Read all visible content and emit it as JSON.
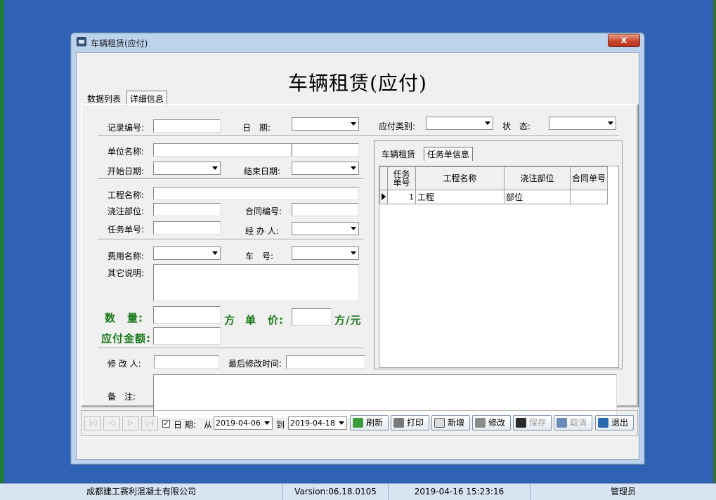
{
  "window": {
    "title": "车辆租赁(应付)",
    "close_label": "x",
    "heading": "车辆租赁(应付)"
  },
  "tabs": [
    {
      "label": "数据列表",
      "active": false
    },
    {
      "label": "详细信息",
      "active": true
    }
  ],
  "form": {
    "record_no_label": "记录编号:",
    "date_label": "日　期:",
    "payable_type_label": "应付类别:",
    "status_label": "状　态:",
    "unit_name_label": "单位名称:",
    "start_date_label": "开始日期:",
    "end_date_label": "结束日期:",
    "project_name_label": "工程名称:",
    "pour_part_label": "浇注部位:",
    "contract_no_label": "合同编号:",
    "task_no_label": "任务单号:",
    "handler_label": "经 办 人:",
    "fee_name_label": "费用名称:",
    "vehicle_no_label": "车　号:",
    "other_desc_label": "其它说明:",
    "quantity_label": "数　量:",
    "quantity_unit": "方",
    "unit_price_label": "单　价:",
    "unit_price_unit": "方/元",
    "payable_amount_label": "应付金额:",
    "modifier_label": "修 改 人:",
    "last_modified_label": "最后修改时间:",
    "remark_label": "备　注:"
  },
  "right_panel": {
    "tabs": [
      {
        "label": "车辆租赁",
        "active": false
      },
      {
        "label": "任务单信息",
        "active": true
      }
    ],
    "columns": [
      "任务单号",
      "工程名称",
      "浇注部位",
      "合同单号"
    ],
    "rows": [
      {
        "task_no": "1",
        "project": "工程",
        "part": "部位",
        "contract": ""
      }
    ]
  },
  "toolbar": {
    "nav": [
      "|◁",
      "◁",
      "▷",
      "▷|"
    ],
    "date_checkbox_label": "日 期:",
    "from_label": "从",
    "from_date": "2019-04-06",
    "to_label": "到",
    "to_date": "2019-04-18",
    "buttons": [
      {
        "label": "刷新",
        "icon": "refresh-icon",
        "enabled": true
      },
      {
        "label": "打印",
        "icon": "print-icon",
        "enabled": true
      },
      {
        "label": "新增",
        "icon": "add-icon",
        "enabled": true
      },
      {
        "label": "修改",
        "icon": "edit-icon",
        "enabled": true
      },
      {
        "label": "保存",
        "icon": "save-icon",
        "enabled": false
      },
      {
        "label": "取消",
        "icon": "undo-icon",
        "enabled": false
      },
      {
        "label": "退出",
        "icon": "exit-icon",
        "enabled": true
      }
    ]
  },
  "statusbar": {
    "company": "成都建工赛利混凝土有限公司",
    "version": "Varsion:06.18.0105",
    "datetime": "2019-04-16 15:23:16",
    "user": "管理员"
  }
}
